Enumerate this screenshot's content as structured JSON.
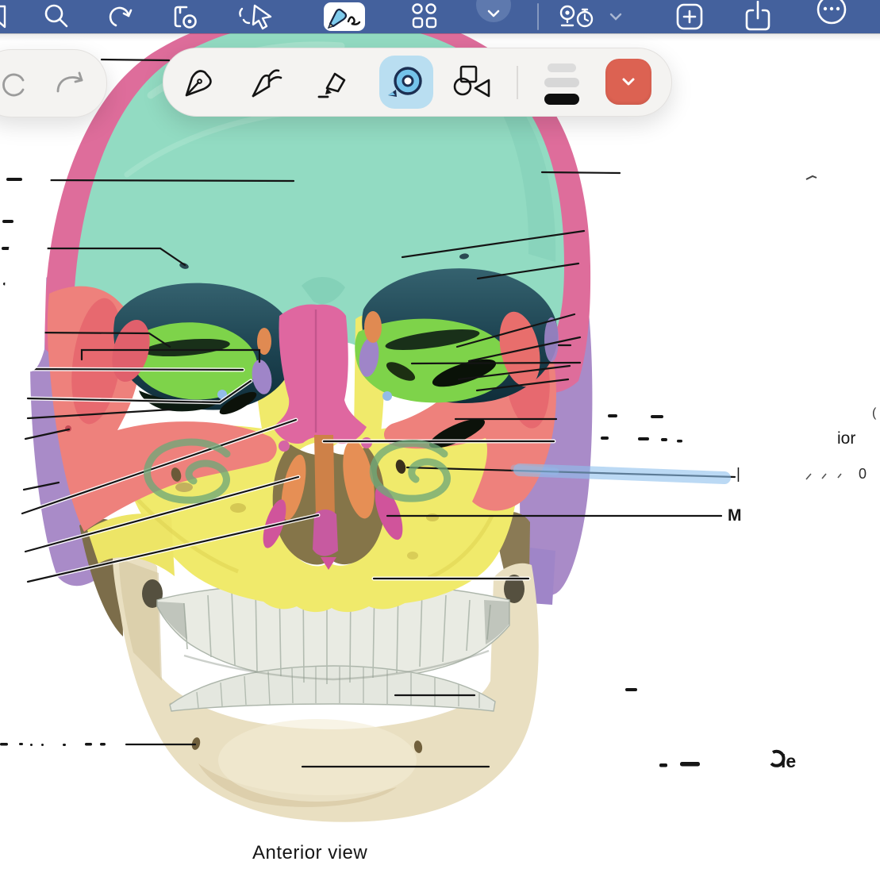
{
  "app": {
    "kind": "note-taking annotation app over anatomy figure",
    "topbar_color": "#44619D"
  },
  "topbar": {
    "icons": [
      "bookmark-icon",
      "search-icon",
      "rotate-icon",
      "page-view-icon",
      "lasso-icon",
      "pen-mode-icon",
      "elements-icon",
      "collapse-icon",
      "present-timer-icon",
      "add-icon",
      "share-icon",
      "more-icon"
    ]
  },
  "toolbars": {
    "history": {
      "buttons": [
        "undo",
        "redo"
      ]
    },
    "pens": {
      "tools": [
        "fountain-pen",
        "ballpoint-pen",
        "highlighter",
        "tape",
        "shapes"
      ],
      "selected_tool": "tape",
      "selected_tool_bg": "#B9DEF1",
      "thickness_levels": 3,
      "selected_thickness": 3,
      "color_swatch": "#DC6252"
    }
  },
  "figure": {
    "caption": "Anterior view",
    "subject": "human skull, anterior view, bones color coded",
    "colors": {
      "frontal": "#92DBC2",
      "parietal": "#DE6D9B",
      "temporal": "#A98BC8",
      "sphenoid": "#EC7372",
      "orbit": "#14333E",
      "ethmoid_green": "#7ED34A",
      "conchae_orange": "#E68F55",
      "nasal_pink": "#DF67A0",
      "vomer_magenta": "#D0549B",
      "maxilla_yellow": "#F0EA6B",
      "mandible_bone": "#E9DFC1"
    }
  },
  "fragments": {
    "maxilla_initial": "M",
    "mandible_suffix": "le",
    "right_edge_word": "ior",
    "zero_mark": "0",
    "tick_mark": "|",
    "paren_mark": "("
  },
  "annotations": {
    "highlighter_color": "#8FC1EE",
    "pen_loop_color": "#6FA878",
    "leader_line_color": "#141414"
  }
}
